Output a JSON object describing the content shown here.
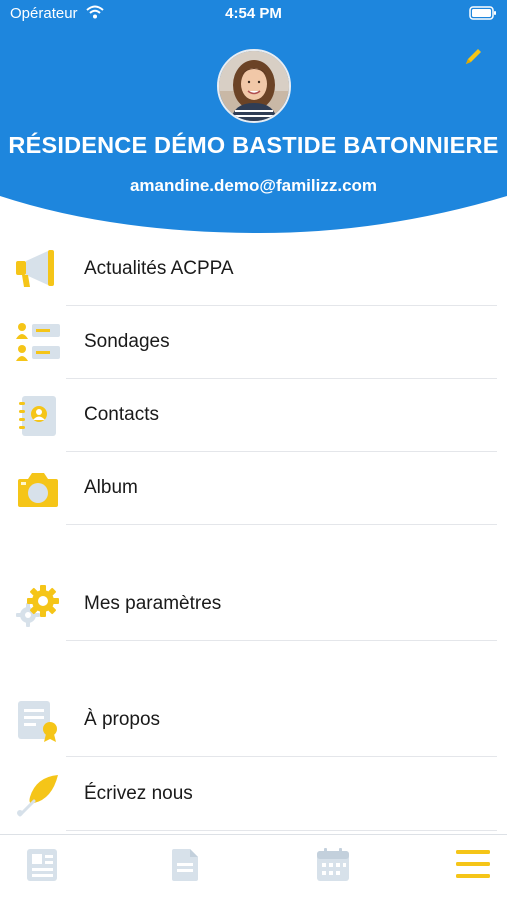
{
  "status_bar": {
    "carrier": "Opérateur",
    "time": "4:54 PM"
  },
  "header": {
    "title": "RÉSIDENCE DÉMO BASTIDE BATONNIERE",
    "email": "amandine.demo@familizz.com"
  },
  "menu": {
    "items": [
      {
        "label": "Actualités ACPPA",
        "icon": "megaphone-icon"
      },
      {
        "label": "Sondages",
        "icon": "poll-icon"
      },
      {
        "label": "Contacts",
        "icon": "contacts-book-icon"
      },
      {
        "label": "Album",
        "icon": "camera-icon"
      },
      {
        "label": "Mes paramètres",
        "icon": "gear-icon"
      },
      {
        "label": "À propos",
        "icon": "certificate-icon"
      },
      {
        "label": "Écrivez nous",
        "icon": "quill-icon"
      }
    ]
  },
  "tabbar": {
    "tabs": [
      {
        "icon": "news-icon"
      },
      {
        "icon": "document-icon"
      },
      {
        "icon": "calendar-icon"
      },
      {
        "icon": "hamburger-menu-icon"
      }
    ]
  },
  "colors": {
    "header_blue": "#1e86dd",
    "accent_yellow": "#f5c518",
    "icon_grey": "#d7e1ea"
  }
}
